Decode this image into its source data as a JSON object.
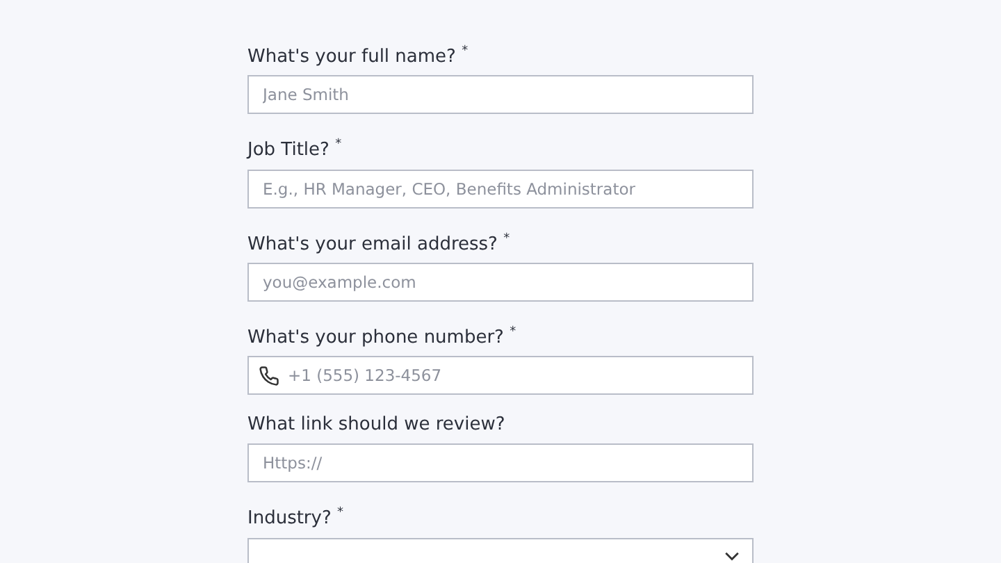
{
  "fields": [
    {
      "kind": "text",
      "label": "What's your full name? $^{*}$",
      "placeholder": "Jane Smith"
    },
    {
      "kind": "text",
      "label": "Job Title? $^{*}$",
      "placeholder": "E.g., HR Manager, CEO, Benefits Administrator"
    },
    {
      "kind": "text",
      "label": "What's your email address? $^{*}$",
      "placeholder": "you@example.com"
    },
    {
      "kind": "phone",
      "label": "What's your phone number? $^{*}$",
      "placeholder": "+1 (555) 123-4567"
    },
    {
      "kind": "text",
      "label": "What link should we review?",
      "placeholder": "Https://"
    },
    {
      "kind": "select",
      "label": "Industry? $^{*}$"
    }
  ]
}
